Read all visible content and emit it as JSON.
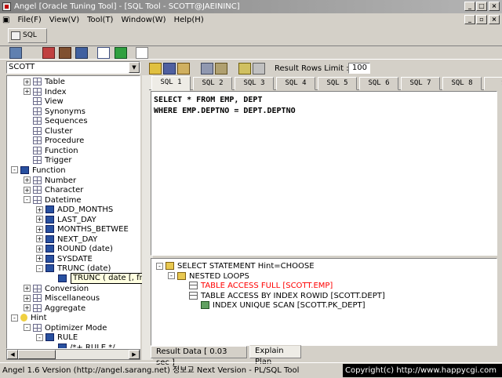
{
  "window": {
    "title": "Angel [Oracle Tuning Tool] - [SQL Tool - SCOTT@JAEININC]"
  },
  "menu": {
    "items": [
      "File(F)",
      "View(V)",
      "Tool(T)",
      "Window(W)",
      "Help(H)"
    ]
  },
  "doc_tab": {
    "label": "SQL"
  },
  "schema_select": {
    "value": "SCOTT"
  },
  "tree": {
    "items": [
      {
        "label": "Table",
        "level": 1,
        "expander": "+",
        "icon": "grid-icon"
      },
      {
        "label": "Index",
        "level": 1,
        "expander": "+",
        "icon": "grid-icon"
      },
      {
        "label": "View",
        "level": 1,
        "expander": "",
        "icon": "grid-icon"
      },
      {
        "label": "Synonyms",
        "level": 1,
        "expander": "",
        "icon": "grid-icon"
      },
      {
        "label": "Sequences",
        "level": 1,
        "expander": "",
        "icon": "grid-icon"
      },
      {
        "label": "Cluster",
        "level": 1,
        "expander": "",
        "icon": "grid-icon"
      },
      {
        "label": "Procedure",
        "level": 1,
        "expander": "",
        "icon": "grid-icon"
      },
      {
        "label": "Function",
        "level": 1,
        "expander": "",
        "icon": "grid-icon"
      },
      {
        "label": "Trigger",
        "level": 1,
        "expander": "",
        "icon": "grid-icon"
      },
      {
        "label": "Function",
        "level": 0,
        "expander": "-",
        "icon": "function-icon"
      },
      {
        "label": "Number",
        "level": 1,
        "expander": "+",
        "icon": "grid-icon"
      },
      {
        "label": "Character",
        "level": 1,
        "expander": "+",
        "icon": "grid-icon"
      },
      {
        "label": "Datetime",
        "level": 1,
        "expander": "-",
        "icon": "grid-icon"
      },
      {
        "label": "ADD_MONTHS",
        "level": 2,
        "expander": "+",
        "icon": "function-icon"
      },
      {
        "label": "LAST_DAY",
        "level": 2,
        "expander": "+",
        "icon": "function-icon"
      },
      {
        "label": "MONTHS_BETWEE",
        "level": 2,
        "expander": "+",
        "icon": "function-icon"
      },
      {
        "label": "NEXT_DAY",
        "level": 2,
        "expander": "+",
        "icon": "function-icon"
      },
      {
        "label": "ROUND (date)",
        "level": 2,
        "expander": "+",
        "icon": "function-icon"
      },
      {
        "label": "SYSDATE",
        "level": 2,
        "expander": "+",
        "icon": "function-icon"
      },
      {
        "label": "TRUNC (date)",
        "level": 2,
        "expander": "-",
        "icon": "function-icon"
      },
      {
        "label": "",
        "level": 3,
        "expander": "",
        "icon": "function-icon"
      },
      {
        "label": "Conversion",
        "level": 1,
        "expander": "+",
        "icon": "grid-icon"
      },
      {
        "label": "Miscellaneous",
        "level": 1,
        "expander": "+",
        "icon": "grid-icon"
      },
      {
        "label": "Aggregate",
        "level": 1,
        "expander": "+",
        "icon": "grid-icon"
      },
      {
        "label": "Hint",
        "level": 0,
        "expander": "-",
        "icon": "bulb-icon"
      },
      {
        "label": "Optimizer Mode",
        "level": 1,
        "expander": "-",
        "icon": "grid-icon"
      },
      {
        "label": "RULE",
        "level": 2,
        "expander": "-",
        "icon": "function-icon"
      },
      {
        "label": "/*+ RULE */",
        "level": 3,
        "expander": "",
        "icon": "function-icon"
      }
    ]
  },
  "tooltip": {
    "text": "TRUNC ( date [, fmt] )"
  },
  "sql_toolbar": {
    "result_rows_label": "Result Rows Limit :",
    "result_rows_value": "100"
  },
  "sql_tabs": [
    "SQL 1",
    "SQL 2",
    "SQL 3",
    "SQL 4",
    "SQL 5",
    "SQL 6",
    "SQL 7",
    "SQL 8",
    "S"
  ],
  "editor": {
    "line1": "SELECT * FROM EMP, DEPT",
    "line2": "WHERE EMP.DEPTNO = DEPT.DEPTNO"
  },
  "plan": {
    "nodes": [
      {
        "label": "SELECT STATEMENT  Hint=CHOOSE",
        "level": 0,
        "color": "#000000",
        "icon": "folder-icon"
      },
      {
        "label": "NESTED LOOPS",
        "level": 1,
        "color": "#000000",
        "icon": "folder-icon"
      },
      {
        "label": "TABLE ACCESS FULL [SCOTT.EMP]",
        "level": 2,
        "color": "#ff0000",
        "icon": "table-icon"
      },
      {
        "label": "TABLE ACCESS BY INDEX ROWID [SCOTT.DEPT]",
        "level": 2,
        "color": "#000000",
        "icon": "table-icon"
      },
      {
        "label": "INDEX UNIQUE SCAN [SCOTT.PK_DEPT]",
        "level": 3,
        "color": "#000000",
        "icon": "index-icon"
      }
    ]
  },
  "bottom_tabs": [
    "Result Data [ 0.03 sec ]",
    "Explain Plan"
  ],
  "status": {
    "left": "Angel 1.6 Version (http://angel.sarang.net) 정보교 Next Version - PL/SQL Tool",
    "right": "Copyright(c) http://www.happycgi.com"
  }
}
